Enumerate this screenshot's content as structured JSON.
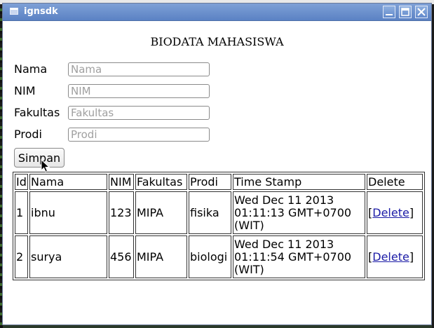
{
  "window": {
    "title": "ignsdk"
  },
  "page": {
    "heading": "BIODATA MAHASISWA"
  },
  "form": {
    "fields": [
      {
        "label": "Nama",
        "placeholder": "Nama",
        "value": ""
      },
      {
        "label": "NIM",
        "placeholder": "NIM",
        "value": ""
      },
      {
        "label": "Fakultas",
        "placeholder": "Fakultas",
        "value": ""
      },
      {
        "label": "Prodi",
        "placeholder": "Prodi",
        "value": ""
      }
    ],
    "submit_label": "Simpan"
  },
  "table": {
    "columns": [
      "Id",
      "Nama",
      "NIM",
      "Fakultas",
      "Prodi",
      "Time Stamp",
      "Delete"
    ],
    "rows": [
      {
        "id": "1",
        "nama": "ibnu",
        "nim": "123",
        "fakultas": "MIPA",
        "prodi": "fisika",
        "ts1": "Wed Dec 11 2013",
        "ts2": "01:11:13 GMT+0700",
        "ts3": "(WIT)",
        "del_open": "[",
        "del_label": "Delete",
        "del_close": "]"
      },
      {
        "id": "2",
        "nama": "surya",
        "nim": "456",
        "fakultas": "MIPA",
        "prodi": "biologi",
        "ts1": "Wed Dec 11 2013",
        "ts2": "01:11:54 GMT+0700",
        "ts3": "(WIT)",
        "del_open": "[",
        "del_label": "Delete",
        "del_close": "]"
      }
    ]
  },
  "icons": {
    "app": "window-app-icon",
    "minimize": "minimize-icon",
    "maximize": "maximize-icon",
    "close": "close-icon",
    "cursor": "mouse-pointer-icon"
  }
}
